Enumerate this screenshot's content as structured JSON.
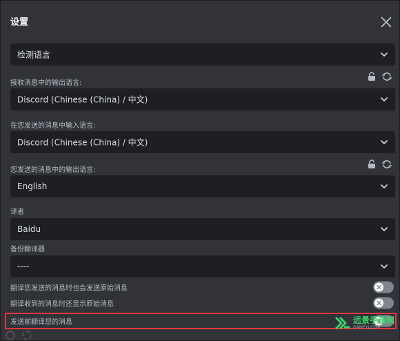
{
  "dialog": {
    "title": "设置"
  },
  "fields": [
    {
      "label": "",
      "value": "检测语言",
      "has_actions": false
    },
    {
      "label": "接收消息中的输出语言:",
      "value": "Discord (Chinese (China) / 中文)",
      "has_actions": true
    },
    {
      "label": "在您发送的消息中输入语言:",
      "value": "Discord (Chinese (China) / 中文)",
      "has_actions": false
    },
    {
      "label": "您发送的消息中的输出语言:",
      "value": "English",
      "has_actions": true
    },
    {
      "label": "译者",
      "value": "Baidu",
      "has_actions": false
    },
    {
      "label": "备份翻译器",
      "value": "----",
      "has_actions": false
    }
  ],
  "toggles": [
    {
      "label": "翻译您发送的消息时也会发送原始消息",
      "on": false
    },
    {
      "label": "翻译收到的消息时还显示原始消息",
      "on": false
    },
    {
      "label": "发送前翻译您的消息",
      "on": false
    }
  ],
  "icons": {
    "close": "close-icon",
    "chevron": "chevron-down-icon",
    "lock": "lock-icon",
    "swap": "swap-icon",
    "toggle_off": "x-icon"
  },
  "watermark": {
    "text": "远景手游网",
    "sub": "GAMEYJ.COM"
  },
  "colors": {
    "background": "#313338",
    "input": "#1e1f22",
    "highlight": "#e0373f",
    "toggle_off": "#80848e"
  }
}
